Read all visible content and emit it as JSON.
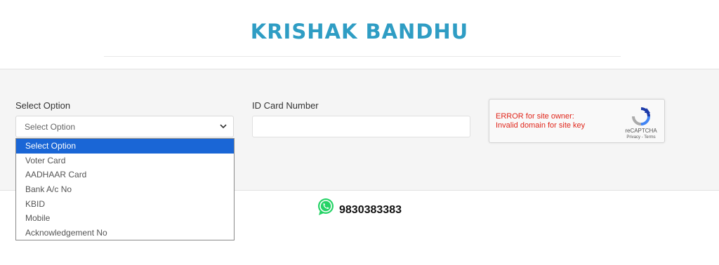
{
  "header": {
    "title": "KRISHAK BANDHU"
  },
  "form": {
    "select_label": "Select Option",
    "select_value": "Select Option",
    "id_label": "ID Card Number",
    "id_value": ""
  },
  "dropdown": {
    "options": [
      "Select Option",
      "Voter Card",
      "AADHAAR Card",
      "Bank A/c No",
      "KBID",
      "Mobile",
      "Acknowledgement No"
    ],
    "selected_index": 0
  },
  "captcha": {
    "error_line1": "ERROR for site owner:",
    "error_line2": "Invalid domain for site key",
    "brand": "reCAPTCHA",
    "links": "Privacy - Terms"
  },
  "contact": {
    "icon": "whatsapp-icon",
    "phone": "9830383383"
  },
  "colors": {
    "accent": "#2f9dc4",
    "selected": "#1a66d6",
    "error": "#e0261b",
    "whatsapp": "#25d366"
  }
}
